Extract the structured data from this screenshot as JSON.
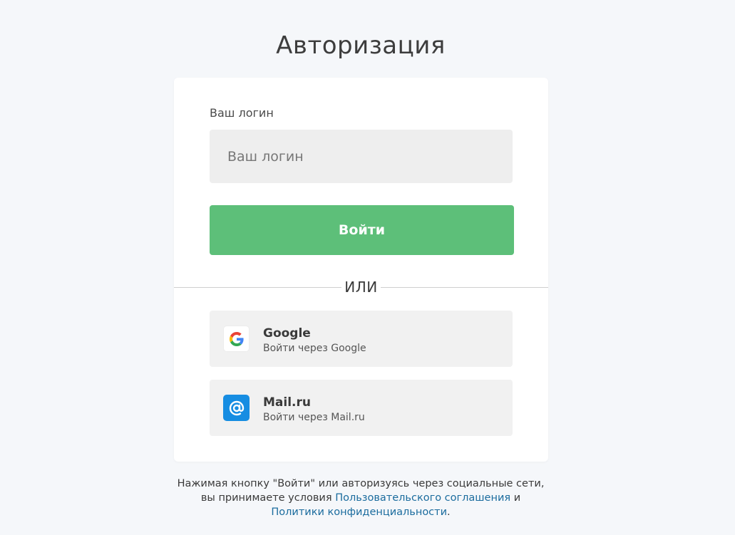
{
  "page": {
    "title": "Авторизация"
  },
  "form": {
    "login_label": "Ваш логин",
    "login_value": "",
    "login_placeholder": "Ваш логин",
    "submit_label": "Войти",
    "divider_text": "ИЛИ"
  },
  "social": [
    {
      "icon": "google-icon",
      "name": "Google",
      "subtitle": "Войти через Google"
    },
    {
      "icon": "mailru-icon",
      "name": "Mail.ru",
      "subtitle": "Войти через Mail.ru"
    }
  ],
  "terms": {
    "line1": "Нажимая кнопку \"Войти\" или авторизуясь через социальные сети,",
    "line2_prefix": "вы принимаете условия ",
    "user_agreement_link": "Пользовательского соглашения",
    "line2_suffix": " и",
    "privacy_link": "Политики конфиденциальности",
    "line3_suffix": "."
  },
  "colors": {
    "background": "#f5f7fa",
    "card": "#ffffff",
    "input_bg": "#eeeeee",
    "primary_button": "#5dbf79",
    "social_bg": "#f1f1f1",
    "mailru_blue": "#168de2",
    "link": "#1b6c9e"
  }
}
